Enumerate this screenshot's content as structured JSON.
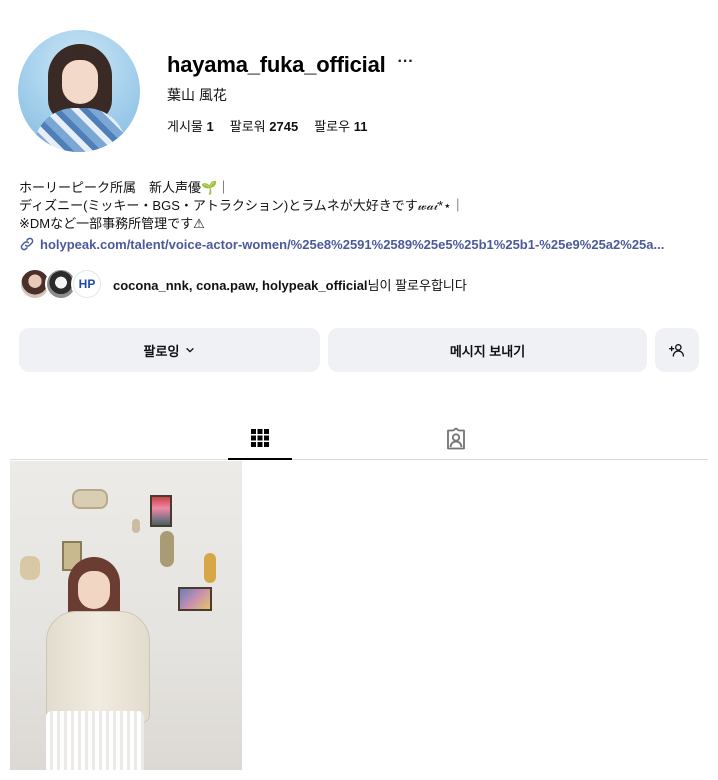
{
  "profile": {
    "username": "hayama_fuka_official",
    "full_name": "葉山 風花",
    "stats": [
      {
        "label": "게시물",
        "value": "1"
      },
      {
        "label": "팔로워",
        "value": "2745"
      },
      {
        "label": "팔로우",
        "value": "11"
      }
    ],
    "bio_lines": [
      "ホーリーピーク所属　新人声優🌱｜",
      "ディズニー(ミッキー・BGS・アトラクション)とラムネが大好きです𝓌𝒶𝒾*⋆｜",
      "※DMなど一部事務所管理です⚠"
    ],
    "link": "holypeak.com/talent/voice-actor-women/%25e8%2591%2589%25e5%25b1%25b1-%25e9%25a2%25a..."
  },
  "followed_by": {
    "names": "cocona_nnk, cona.paw, holypeak_official",
    "suffix": "님이 팔로우합니다",
    "logo_text": "HP"
  },
  "actions": {
    "following_label": "팔로잉",
    "message_label": "메시지 보내기"
  },
  "tabs": [
    "grid-icon",
    "tagged-icon"
  ],
  "icons": {
    "more": "more-icon",
    "link": "link-icon",
    "chevron": "chevron-down-icon",
    "add_user": "add-user-icon"
  },
  "colors": {
    "link": "#4b5a9b",
    "button_bg": "#eff1f4",
    "divider": "#dbdbdb"
  }
}
